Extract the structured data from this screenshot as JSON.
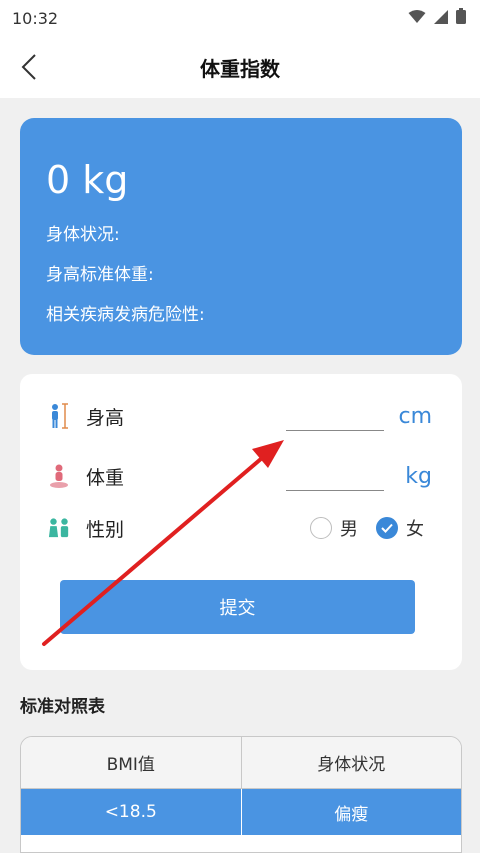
{
  "status_bar": {
    "time": "10:32",
    "icons": [
      "wifi-icon",
      "signal-icon",
      "battery-icon"
    ]
  },
  "app_bar": {
    "title": "体重指数",
    "back_icon": "chevron-left-icon"
  },
  "result": {
    "value": "0 kg",
    "body_status_label": "身体状况:",
    "standard_weight_label": "身高标准体重:",
    "risk_label": "相关疾病发病危险性:"
  },
  "form": {
    "height": {
      "label": "身高",
      "value": "",
      "unit": "cm",
      "icon": "height-icon"
    },
    "weight": {
      "label": "体重",
      "value": "",
      "unit": "kg",
      "icon": "weight-icon"
    },
    "gender": {
      "label": "性别",
      "icon": "gender-icon",
      "options": [
        {
          "label": "男",
          "checked": false
        },
        {
          "label": "女",
          "checked": true
        }
      ]
    },
    "submit_label": "提交"
  },
  "reference": {
    "title": "标准对照表",
    "columns": [
      "BMI值",
      "身体状况"
    ],
    "rows": [
      [
        "<18.5",
        "偏瘦"
      ]
    ]
  },
  "colors": {
    "primary": "#4a94e2",
    "unit": "#3a88d8",
    "annotation_arrow": "#e02020"
  }
}
